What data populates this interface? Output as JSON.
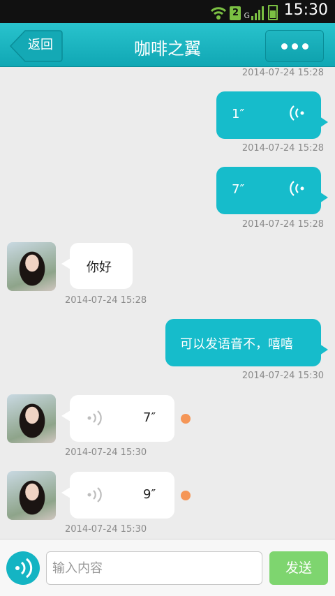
{
  "status_bar": {
    "time": "15:30",
    "sim_slot": "2",
    "network_type": "G"
  },
  "header": {
    "back_label": "返回",
    "title": "咖啡之翼"
  },
  "messages": [
    {
      "dir": "out",
      "kind": "voice",
      "duration": "1″",
      "timestamp": "2014-07-24 15:28"
    },
    {
      "dir": "out",
      "kind": "voice",
      "duration": "7″",
      "timestamp": "2014-07-24 15:28"
    },
    {
      "dir": "in",
      "kind": "text",
      "text": "你好",
      "timestamp": "2014-07-24 15:28"
    },
    {
      "dir": "out",
      "kind": "text",
      "text": "可以发语音不，嘻嘻",
      "timestamp": "2014-07-24 15:30"
    },
    {
      "dir": "in",
      "kind": "voice",
      "duration": "7″",
      "timestamp": "2014-07-24 15:30",
      "unread": true
    },
    {
      "dir": "in",
      "kind": "voice",
      "duration": "9″",
      "timestamp": "2014-07-24 15:30",
      "unread": true
    }
  ],
  "top_timestamp": "2014-07-24 15:28",
  "composer": {
    "placeholder": "输入内容",
    "value": "",
    "send_label": "发送"
  },
  "colors": {
    "header": "#16b1bd",
    "bubble_out": "#16bccb",
    "send": "#7ed56f",
    "unread_dot": "#f59657"
  }
}
